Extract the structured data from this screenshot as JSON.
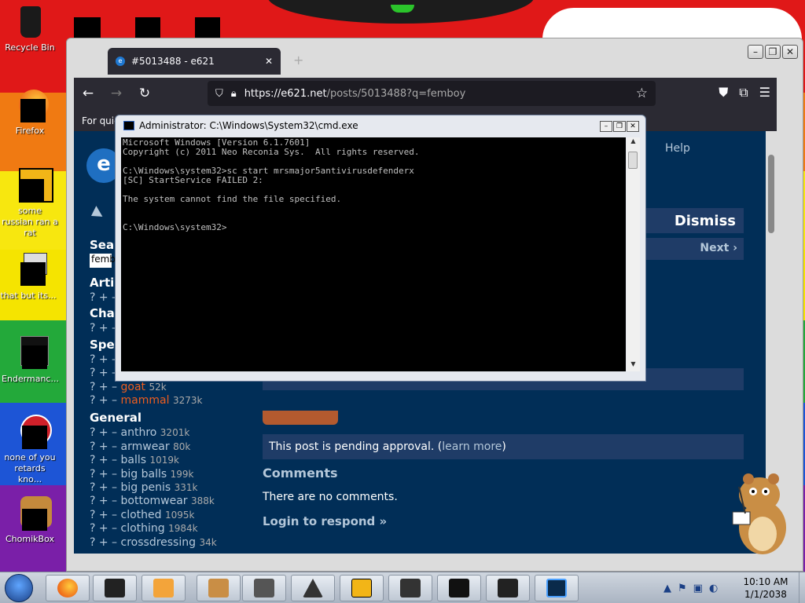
{
  "desktop": {
    "icons": [
      {
        "label": "Recycle Bin"
      },
      {
        "label": "Firefox"
      },
      {
        "label": "some russian ran a rat"
      },
      {
        "label": "that but its..."
      },
      {
        "label": "Endermanc..."
      },
      {
        "label": "none of you retards kno..."
      },
      {
        "label": "ChomikBox"
      }
    ]
  },
  "browser": {
    "tab_title": "#5013488 - e621",
    "new_tab_glyph": "+",
    "url_domain": "https://e621.net",
    "url_path": "/posts/5013488?q=femboy",
    "bookmarks_text": "For quic",
    "window_caps": [
      "–",
      "❐",
      "✕"
    ]
  },
  "site": {
    "logo_text": "e",
    "nav_help": "Help",
    "dismiss": "Dismiss",
    "next": "Next ›",
    "search_label": "Sea",
    "search_value": "femb",
    "sections": {
      "artist": "Arti",
      "character": "Cha",
      "species": "Spe",
      "general": "General"
    },
    "species_tags": [
      {
        "name": "goat",
        "count": "52k"
      },
      {
        "name": "mammal",
        "count": "3273k"
      }
    ],
    "general_tags": [
      {
        "name": "anthro",
        "count": "3201k"
      },
      {
        "name": "armwear",
        "count": "80k"
      },
      {
        "name": "balls",
        "count": "1019k"
      },
      {
        "name": "big balls",
        "count": "199k"
      },
      {
        "name": "big penis",
        "count": "331k"
      },
      {
        "name": "bottomwear",
        "count": "388k"
      },
      {
        "name": "clothed",
        "count": "1095k"
      },
      {
        "name": "clothing",
        "count": "1984k"
      },
      {
        "name": "crossdressing",
        "count": "34k"
      }
    ],
    "tag_prefix": "? + –",
    "pending_text": "This post is pending approval. (",
    "pending_link": "learn more",
    "pending_close": ")",
    "comments_heading": "Comments",
    "no_comments": "There are no comments.",
    "login_link": "Login to respond »"
  },
  "cmd": {
    "title": "Administrator: C:\\Windows\\System32\\cmd.exe",
    "lines": "Microsoft Windows [Version 6.1.7601]\nCopyright (c) 2011 Neo Reconia Sys.  All rights reserved.\n\nC:\\Windows\\system32>sc start mrsmajor5antivirusdefenderx\n[SC] StartService FAILED 2:\n\nThe system cannot find the file specified.\n\n\nC:\\Windows\\system32>"
  },
  "taskbar": {
    "clock_time": "10:10 AM",
    "clock_date": "1/1/2038"
  },
  "colors": {
    "site_bg": "#012e57",
    "site_panel": "#1f3c67",
    "species_tag": "#ed5d1f",
    "link": "#b4c7d9"
  }
}
